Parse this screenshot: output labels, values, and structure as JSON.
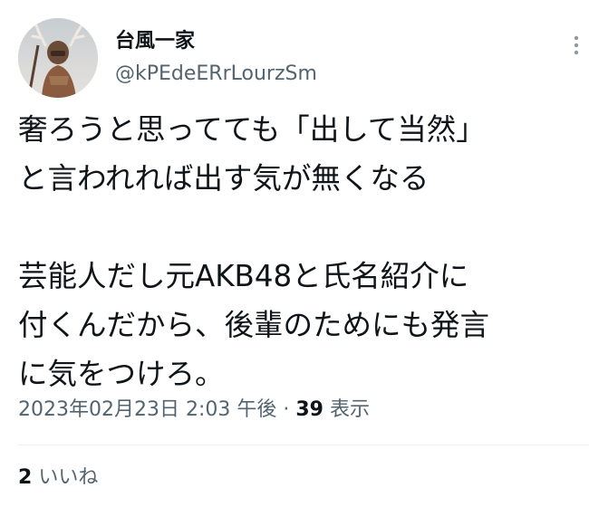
{
  "tweet": {
    "author": {
      "display_name": "台風一家",
      "handle": "@kPEdeERrLourzSm"
    },
    "body": "奢ろうと思ってても「出して当然」\nと言われれば出す気が無くなる\n\n芸能人だし元AKB48と氏名紹介に\n付くんだから、後輩のためにも発言\nに気をつけろ。",
    "timestamp": "2023年02月23日 2:03 午後",
    "separator": "·",
    "views_count": "39",
    "views_label": "表示",
    "likes_count": "2",
    "likes_label": "いいね"
  },
  "icons": {
    "more": "more-vertical-icon",
    "avatar": "avatar-image"
  },
  "colors": {
    "text_primary": "#0f1419",
    "text_secondary": "#536471",
    "divider": "#eff3f4",
    "background": "#ffffff"
  }
}
